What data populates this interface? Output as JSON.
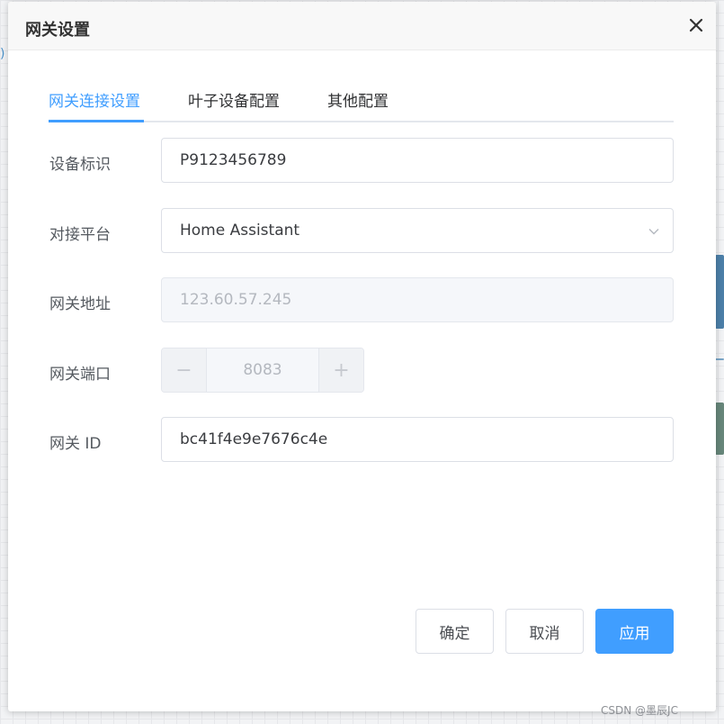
{
  "dialog": {
    "title": "网关设置",
    "close_icon": "close-icon"
  },
  "tabs": [
    {
      "label": "网关连接设置",
      "active": true
    },
    {
      "label": "叶子设备配置",
      "active": false
    },
    {
      "label": "其他配置",
      "active": false
    }
  ],
  "form": {
    "device_id": {
      "label": "设备标识",
      "value": "P9123456789"
    },
    "platform": {
      "label": "对接平台",
      "value": "Home Assistant"
    },
    "gateway_address": {
      "label": "网关地址",
      "value": "123.60.57.245"
    },
    "gateway_port": {
      "label": "网关端口",
      "value": "8083",
      "minus": "−",
      "plus": "+"
    },
    "gateway_id": {
      "label": "网关 ID",
      "value": "bc41f4e9e7676c4e"
    }
  },
  "buttons": {
    "confirm": "确定",
    "cancel": "取消",
    "apply": "应用"
  },
  "background": {
    "fragment_left": ")"
  },
  "watermark": "CSDN @墨辰JC",
  "colors": {
    "primary": "#409eff",
    "disabled_bg": "#f5f7fa",
    "border": "#dcdfe6"
  }
}
